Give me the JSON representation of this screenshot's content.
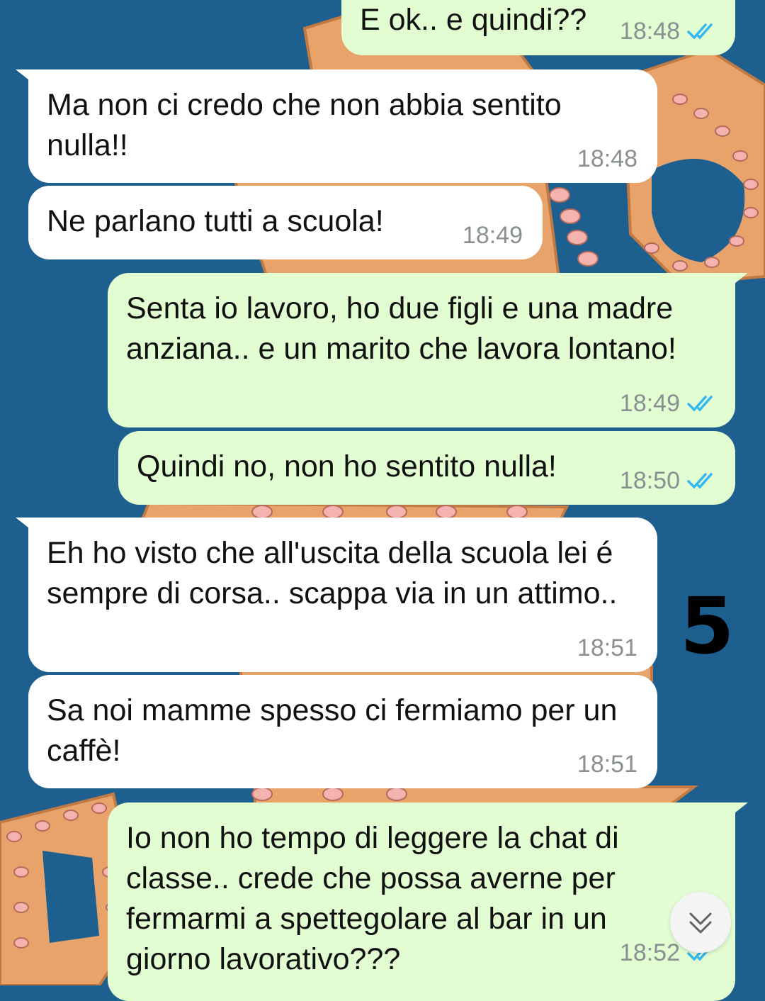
{
  "chat": {
    "messages": [
      {
        "direction": "out",
        "text": "E ok.. e quindi??",
        "time": "18:48",
        "read": true
      },
      {
        "direction": "in",
        "text": "Ma non ci credo che non abbia sentito nulla!!",
        "time": "18:48"
      },
      {
        "direction": "in",
        "text": "Ne parlano tutti a scuola!",
        "time": "18:49"
      },
      {
        "direction": "out",
        "text": "Senta io lavoro, ho due figli e una madre anziana.. e un marito che lavora lontano!",
        "time": "18:49",
        "read": true
      },
      {
        "direction": "out",
        "text": "Quindi no, non ho sentito nulla!",
        "time": "18:50",
        "read": true
      },
      {
        "direction": "in",
        "text": "Eh ho visto che all'uscita della scuola lei é sempre di corsa.. scappa via in un attimo..",
        "time": "18:51"
      },
      {
        "direction": "in",
        "text": "Sa noi mamme spesso ci fermiamo per un caffè!",
        "time": "18:51"
      },
      {
        "direction": "out",
        "text": "Io non ho tempo di leggere la chat di classe.. crede che possa averne per fermarmi a spettegolare al bar in un giorno lavorativo???",
        "time": "18:52",
        "read": true
      }
    ]
  },
  "annotation": {
    "text": "5"
  },
  "icons": {
    "read_ticks": "double-check-icon",
    "scroll_down": "chevron-double-down-icon"
  },
  "colors": {
    "background": "#1d5f8e",
    "incoming_bubble": "#ffffff",
    "outgoing_bubble": "#e2fdd2",
    "read_ticks": "#34b7f1",
    "timestamp": "#8a8f92",
    "wallpaper_octopus": "#e7a36a",
    "wallpaper_suckers": "#f5b3b0"
  }
}
